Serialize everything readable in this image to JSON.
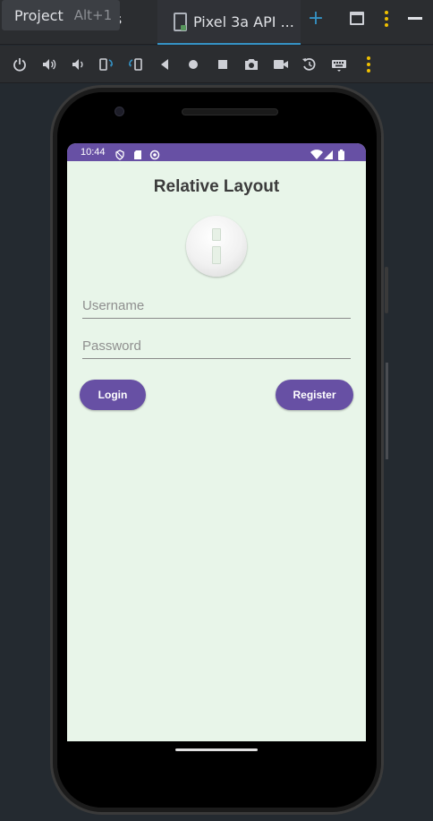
{
  "ide": {
    "tooltip_label": "Project",
    "tooltip_shortcut": "Alt+1",
    "behind_tab_text": "es",
    "active_tab_label": "Pixel 3a API ...",
    "new_tab_glyph": "+",
    "accent_color": "#3592c4",
    "menu_dot_color": "#f0c000"
  },
  "emulator_toolbar": {
    "icons": [
      "power-icon",
      "volume-up-icon",
      "volume-down-icon",
      "rotate-left-icon",
      "rotate-right-icon",
      "back-icon",
      "home-icon",
      "overview-icon",
      "screenshot-icon",
      "screen-record-icon",
      "snapshot-icon",
      "keyboard-icon",
      "more-icon"
    ]
  },
  "phone": {
    "status_bar": {
      "time": "10:44",
      "color": "#6750a4"
    },
    "app": {
      "title": "Relative Layout",
      "username_placeholder": "Username",
      "password_placeholder": "Password",
      "login_label": "Login",
      "register_label": "Register",
      "background": "#e8f5e9",
      "primary_color": "#6750a4"
    }
  }
}
